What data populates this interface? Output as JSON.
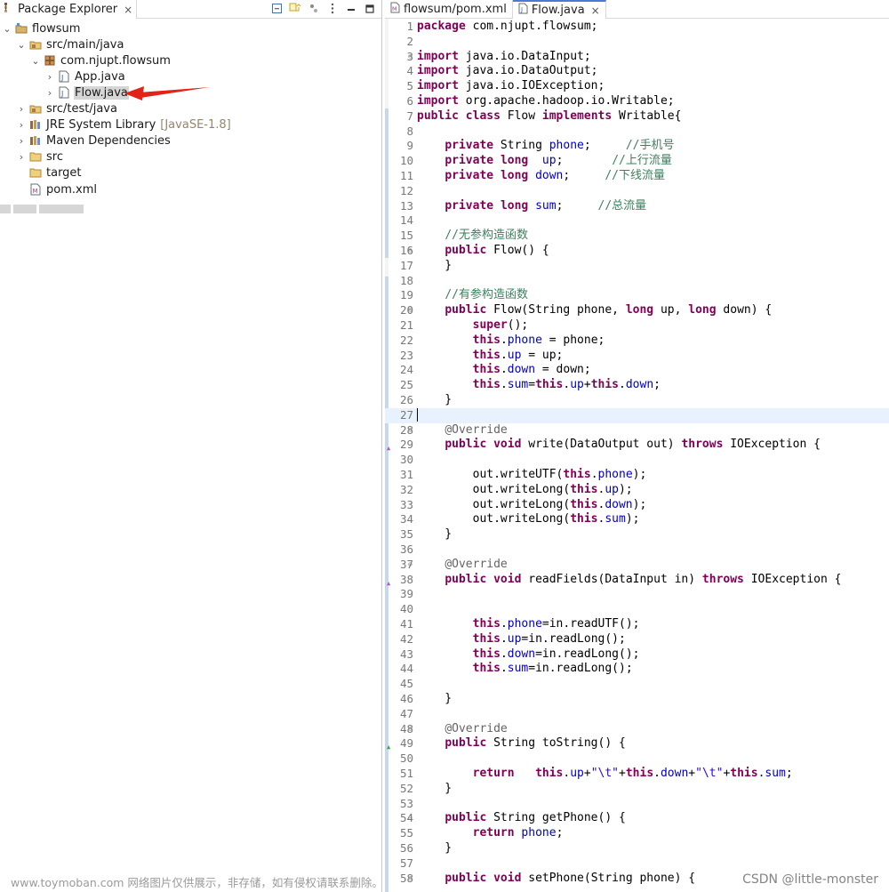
{
  "explorer": {
    "tab_label": "Package Explorer",
    "close_glyph": "×",
    "toolbar": [
      "collapse-all-icon",
      "link-with-editor-icon",
      "filter-icon",
      "view-menu-icon",
      "minimize-icon",
      "maximize-icon"
    ],
    "tree": [
      {
        "label": "flowsum",
        "icon": "project-icon",
        "expanded": true
      },
      {
        "label": "src/main/java",
        "icon": "source-folder-icon",
        "expanded": true
      },
      {
        "label": "com.njupt.flowsum",
        "icon": "package-icon",
        "expanded": true
      },
      {
        "label": "App.java",
        "icon": "java-file-icon",
        "expanded": false
      },
      {
        "label": "Flow.java",
        "icon": "java-file-icon",
        "expanded": false,
        "selected": true
      },
      {
        "label": "src/test/java",
        "icon": "source-folder-icon",
        "expanded": false
      },
      {
        "label": "JRE System Library",
        "decoration": "[JavaSE-1.8]",
        "icon": "library-icon",
        "expanded": false
      },
      {
        "label": "Maven Dependencies",
        "icon": "library-icon",
        "expanded": false
      },
      {
        "label": "src",
        "icon": "folder-icon",
        "expanded": false
      },
      {
        "label": "target",
        "icon": "folder-icon"
      },
      {
        "label": "pom.xml",
        "icon": "xml-file-icon"
      }
    ]
  },
  "editor": {
    "tabs": [
      {
        "label": "flowsum/pom.xml",
        "icon": "maven-pom-icon",
        "active": false
      },
      {
        "label": "Flow.java",
        "icon": "java-file-icon",
        "active": true
      }
    ],
    "current_line": 27,
    "lines": [
      [
        [
          "kw",
          "package"
        ],
        [
          "t",
          " com.njupt.flowsum;"
        ]
      ],
      [],
      [
        [
          "kw",
          "import"
        ],
        [
          "t",
          " java.io.DataInput;"
        ]
      ],
      [
        [
          "kw",
          "import"
        ],
        [
          "t",
          " java.io.DataOutput;"
        ]
      ],
      [
        [
          "kw",
          "import"
        ],
        [
          "t",
          " java.io.IOException;"
        ]
      ],
      [
        [
          "kw",
          "import"
        ],
        [
          "t",
          " org.apache.hadoop.io.Writable;"
        ]
      ],
      [
        [
          "kw",
          "public"
        ],
        [
          "t",
          " "
        ],
        [
          "kw",
          "class"
        ],
        [
          "t",
          " Flow "
        ],
        [
          "kw",
          "implements"
        ],
        [
          "t",
          " Writable{"
        ]
      ],
      [],
      [
        [
          "t",
          "    "
        ],
        [
          "kw",
          "private"
        ],
        [
          "t",
          " String "
        ],
        [
          "fld",
          "phone"
        ],
        [
          "t",
          ";     "
        ],
        [
          "cmt",
          "//手机号"
        ]
      ],
      [
        [
          "t",
          "    "
        ],
        [
          "kw",
          "private"
        ],
        [
          "t",
          " "
        ],
        [
          "kw",
          "long"
        ],
        [
          "t",
          "  "
        ],
        [
          "fld",
          "up"
        ],
        [
          "t",
          ";       "
        ],
        [
          "cmt",
          "//上行流量"
        ]
      ],
      [
        [
          "t",
          "    "
        ],
        [
          "kw",
          "private"
        ],
        [
          "t",
          " "
        ],
        [
          "kw",
          "long"
        ],
        [
          "t",
          " "
        ],
        [
          "fld",
          "down"
        ],
        [
          "t",
          ";     "
        ],
        [
          "cmt",
          "//下线流量"
        ]
      ],
      [],
      [
        [
          "t",
          "    "
        ],
        [
          "kw",
          "private"
        ],
        [
          "t",
          " "
        ],
        [
          "kw",
          "long"
        ],
        [
          "t",
          " "
        ],
        [
          "fld",
          "sum"
        ],
        [
          "t",
          ";     "
        ],
        [
          "cmt",
          "//总流量"
        ]
      ],
      [],
      [
        [
          "t",
          "    "
        ],
        [
          "cmt",
          "//无参构造函数"
        ]
      ],
      [
        [
          "t",
          "    "
        ],
        [
          "kw",
          "public"
        ],
        [
          "t",
          " Flow() {"
        ]
      ],
      [
        [
          "t",
          "    }"
        ]
      ],
      [],
      [
        [
          "t",
          "    "
        ],
        [
          "cmt",
          "//有参构造函数"
        ]
      ],
      [
        [
          "t",
          "    "
        ],
        [
          "kw",
          "public"
        ],
        [
          "t",
          " Flow(String phone, "
        ],
        [
          "kw",
          "long"
        ],
        [
          "t",
          " up, "
        ],
        [
          "kw",
          "long"
        ],
        [
          "t",
          " down) {"
        ]
      ],
      [
        [
          "t",
          "        "
        ],
        [
          "kw",
          "super"
        ],
        [
          "t",
          "();"
        ]
      ],
      [
        [
          "t",
          "        "
        ],
        [
          "kw",
          "this"
        ],
        [
          "t",
          "."
        ],
        [
          "fld",
          "phone"
        ],
        [
          "t",
          " = phone;"
        ]
      ],
      [
        [
          "t",
          "        "
        ],
        [
          "kw",
          "this"
        ],
        [
          "t",
          "."
        ],
        [
          "fld",
          "up"
        ],
        [
          "t",
          " = up;"
        ]
      ],
      [
        [
          "t",
          "        "
        ],
        [
          "kw",
          "this"
        ],
        [
          "t",
          "."
        ],
        [
          "fld",
          "down"
        ],
        [
          "t",
          " = down;"
        ]
      ],
      [
        [
          "t",
          "        "
        ],
        [
          "kw",
          "this"
        ],
        [
          "t",
          "."
        ],
        [
          "fld",
          "sum"
        ],
        [
          "t",
          "="
        ],
        [
          "kw",
          "this"
        ],
        [
          "t",
          "."
        ],
        [
          "fld",
          "up"
        ],
        [
          "t",
          "+"
        ],
        [
          "kw",
          "this"
        ],
        [
          "t",
          "."
        ],
        [
          "fld",
          "down"
        ],
        [
          "t",
          ";"
        ]
      ],
      [
        [
          "t",
          "    }"
        ]
      ],
      [],
      [
        [
          "t",
          "    "
        ],
        [
          "ann",
          "@Override"
        ]
      ],
      [
        [
          "t",
          "    "
        ],
        [
          "kw",
          "public"
        ],
        [
          "t",
          " "
        ],
        [
          "kw",
          "void"
        ],
        [
          "t",
          " write(DataOutput out) "
        ],
        [
          "kw",
          "throws"
        ],
        [
          "t",
          " IOException {"
        ]
      ],
      [],
      [
        [
          "t",
          "        out.writeUTF("
        ],
        [
          "kw",
          "this"
        ],
        [
          "t",
          "."
        ],
        [
          "fld",
          "phone"
        ],
        [
          "t",
          ");"
        ]
      ],
      [
        [
          "t",
          "        out.writeLong("
        ],
        [
          "kw",
          "this"
        ],
        [
          "t",
          "."
        ],
        [
          "fld",
          "up"
        ],
        [
          "t",
          ");"
        ]
      ],
      [
        [
          "t",
          "        out.writeLong("
        ],
        [
          "kw",
          "this"
        ],
        [
          "t",
          "."
        ],
        [
          "fld",
          "down"
        ],
        [
          "t",
          ");"
        ]
      ],
      [
        [
          "t",
          "        out.writeLong("
        ],
        [
          "kw",
          "this"
        ],
        [
          "t",
          "."
        ],
        [
          "fld",
          "sum"
        ],
        [
          "t",
          ");"
        ]
      ],
      [
        [
          "t",
          "    }"
        ]
      ],
      [],
      [
        [
          "t",
          "    "
        ],
        [
          "ann",
          "@Override"
        ]
      ],
      [
        [
          "t",
          "    "
        ],
        [
          "kw",
          "public"
        ],
        [
          "t",
          " "
        ],
        [
          "kw",
          "void"
        ],
        [
          "t",
          " readFields(DataInput in) "
        ],
        [
          "kw",
          "throws"
        ],
        [
          "t",
          " IOException {"
        ]
      ],
      [],
      [],
      [
        [
          "t",
          "        "
        ],
        [
          "kw",
          "this"
        ],
        [
          "t",
          "."
        ],
        [
          "fld",
          "phone"
        ],
        [
          "t",
          "=in.readUTF();"
        ]
      ],
      [
        [
          "t",
          "        "
        ],
        [
          "kw",
          "this"
        ],
        [
          "t",
          "."
        ],
        [
          "fld",
          "up"
        ],
        [
          "t",
          "=in.readLong();"
        ]
      ],
      [
        [
          "t",
          "        "
        ],
        [
          "kw",
          "this"
        ],
        [
          "t",
          "."
        ],
        [
          "fld",
          "down"
        ],
        [
          "t",
          "=in.readLong();"
        ]
      ],
      [
        [
          "t",
          "        "
        ],
        [
          "kw",
          "this"
        ],
        [
          "t",
          "."
        ],
        [
          "fld",
          "sum"
        ],
        [
          "t",
          "=in.readLong();"
        ]
      ],
      [],
      [
        [
          "t",
          "    }"
        ]
      ],
      [],
      [
        [
          "t",
          "    "
        ],
        [
          "ann",
          "@Override"
        ]
      ],
      [
        [
          "t",
          "    "
        ],
        [
          "kw",
          "public"
        ],
        [
          "t",
          " String toString() {"
        ]
      ],
      [],
      [
        [
          "t",
          "        "
        ],
        [
          "kw",
          "return"
        ],
        [
          "t",
          "   "
        ],
        [
          "kw",
          "this"
        ],
        [
          "t",
          "."
        ],
        [
          "fld",
          "up"
        ],
        [
          "t",
          "+"
        ],
        [
          "str",
          "\"\\t\""
        ],
        [
          "t",
          "+"
        ],
        [
          "kw",
          "this"
        ],
        [
          "t",
          "."
        ],
        [
          "fld",
          "down"
        ],
        [
          "t",
          "+"
        ],
        [
          "str",
          "\"\\t\""
        ],
        [
          "t",
          "+"
        ],
        [
          "kw",
          "this"
        ],
        [
          "t",
          "."
        ],
        [
          "fld",
          "sum"
        ],
        [
          "t",
          ";"
        ]
      ],
      [
        [
          "t",
          "    }"
        ]
      ],
      [],
      [
        [
          "t",
          "    "
        ],
        [
          "kw",
          "public"
        ],
        [
          "t",
          " String getPhone() {"
        ]
      ],
      [
        [
          "t",
          "        "
        ],
        [
          "kw",
          "return"
        ],
        [
          "t",
          " "
        ],
        [
          "fld",
          "phone"
        ],
        [
          "t",
          ";"
        ]
      ],
      [
        [
          "t",
          "    }"
        ]
      ],
      [],
      [
        [
          "t",
          "    "
        ],
        [
          "kw",
          "public"
        ],
        [
          "t",
          " "
        ],
        [
          "kw",
          "void"
        ],
        [
          "t",
          " setPhone(String phone) {"
        ]
      ]
    ],
    "fold_lines": [
      3,
      16,
      20,
      28,
      37,
      48,
      54,
      58
    ],
    "override_markers": [
      29,
      38
    ],
    "implement_markers": [
      49
    ]
  },
  "watermarks": {
    "left": "www.toymoban.com 网络图片仅供展示，非存储，如有侵权请联系删除。",
    "right": "CSDN @little-monster"
  }
}
